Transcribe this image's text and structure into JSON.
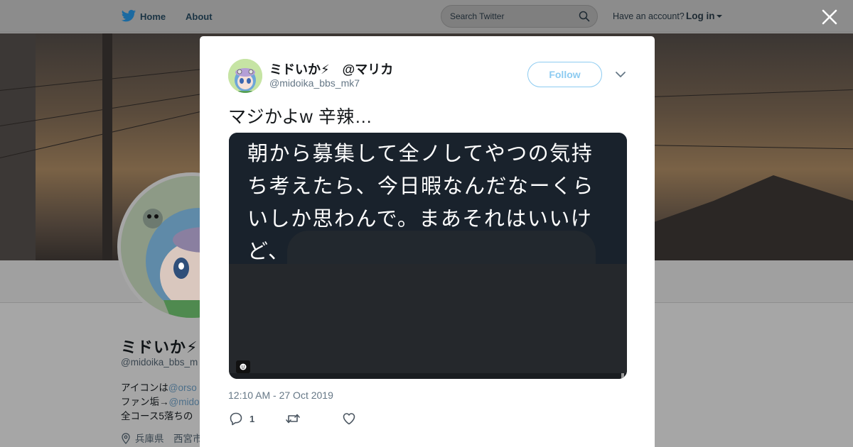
{
  "topbar": {
    "home_label": "Home",
    "about_label": "About",
    "search_placeholder": "Search Twitter",
    "account_question": "Have an account?",
    "login_label": "Log in"
  },
  "profile": {
    "name": "ミドいか⚡",
    "handle": "@midoika_bbs_m",
    "bio_lines": [
      {
        "text": "アイコンは",
        "link": "@orso"
      },
      {
        "text": "ファン垢→",
        "link": "@mido"
      },
      {
        "text": "全コース5落ちの",
        "link": ""
      }
    ],
    "location": "兵庫県　西宮市"
  },
  "tweet": {
    "display_name": "ミドいか⚡　@マリカ",
    "handle": "@midoika_bbs_mk7",
    "follow_label": "Follow",
    "text": "マジかよw 辛辣…",
    "media_lines": [
      "朝から募集して全ノしてやつの気持",
      "ち考えたら、今日暇なんだなーくら",
      "いしか思わんで。まあそれはいいけ",
      "ど、"
    ],
    "timestamp": "12:10 AM - 27 Oct 2019",
    "reply_count": "1"
  },
  "icons": {
    "logo": "twitter-bird-icon",
    "search": "search-icon",
    "close": "close-icon",
    "chevron": "chevron-down-icon",
    "reply": "reply-icon",
    "retweet": "retweet-icon",
    "like": "heart-icon",
    "location": "location-pin-icon",
    "gif": "gif-badge-icon"
  },
  "colors": {
    "twitter_blue": "#1da1f2",
    "follow_border": "#8ccbf1",
    "text_primary": "#14171a",
    "text_secondary": "#657786",
    "media_background": "#19222c"
  }
}
